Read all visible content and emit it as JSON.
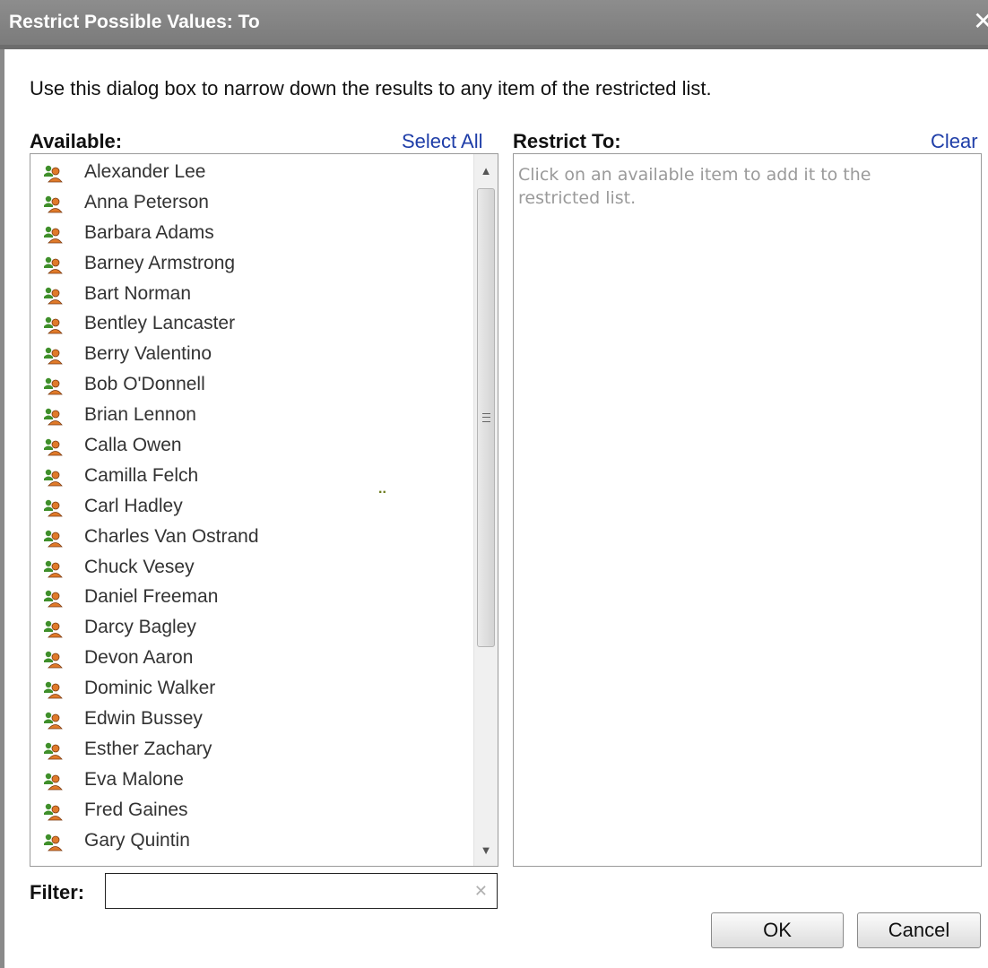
{
  "dialog": {
    "title": "Restrict Possible Values: To",
    "close_glyph": "✕",
    "instructions": "Use this dialog box to narrow down the results to any item of the restricted list."
  },
  "available": {
    "label": "Available:",
    "select_all": "Select All",
    "item_icon": "user-group-icon",
    "items": [
      "Alexander Lee",
      "Anna Peterson",
      "Barbara Adams",
      "Barney Armstrong",
      "Bart Norman",
      "Bentley Lancaster",
      "Berry Valentino",
      "Bob O'Donnell",
      "Brian Lennon",
      "Calla Owen",
      "Camilla Felch",
      "Carl Hadley",
      "Charles Van Ostrand",
      "Chuck Vesey",
      "Daniel Freeman",
      "Darcy Bagley",
      "Devon Aaron",
      "Dominic Walker",
      "Edwin Bussey",
      "Esther Zachary",
      "Eva Malone",
      "Fred Gaines",
      "Gary Quintin"
    ]
  },
  "restrict": {
    "label": "Restrict To:",
    "clear": "Clear",
    "hint": "Click on an available item to add it to the restricted list."
  },
  "loading_dots": "..",
  "filter": {
    "label": "Filter:",
    "value": "",
    "placeholder": "",
    "clear_glyph": "✕"
  },
  "buttons": {
    "ok": "OK",
    "cancel": "Cancel"
  },
  "colors": {
    "titlebar": "#858585",
    "link": "#1f3ea8",
    "hint_text": "#9a9a9a"
  }
}
